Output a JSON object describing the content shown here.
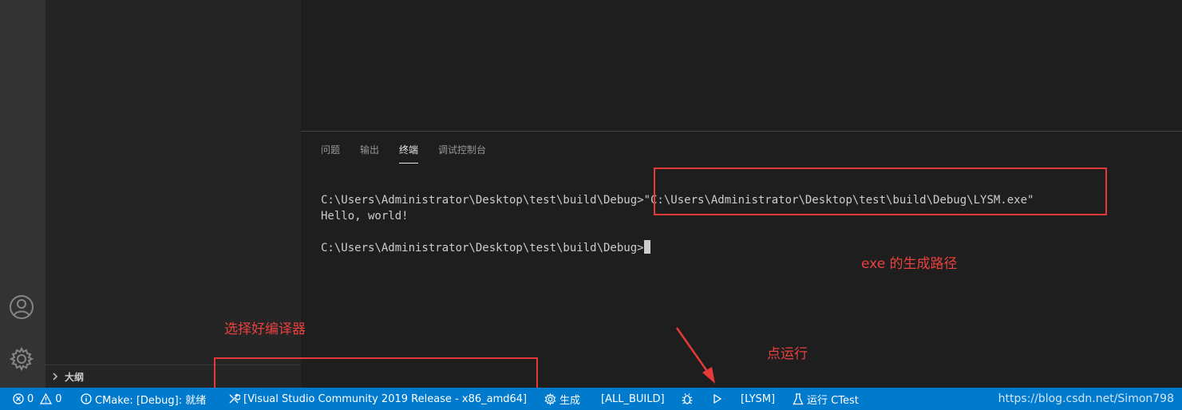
{
  "sidebar": {
    "outline_label": "大纲"
  },
  "panel": {
    "tabs": [
      {
        "label": "问题"
      },
      {
        "label": "输出"
      },
      {
        "label": "终端",
        "active": true
      },
      {
        "label": "调试控制台"
      }
    ]
  },
  "terminal": {
    "line1_prompt": "C:\\Users\\Administrator\\Desktop\\test\\build\\Debug>",
    "line1_command": "\"C:\\Users\\Administrator\\Desktop\\test\\build\\Debug\\LYSM.exe\"",
    "line2": "Hello, world!",
    "line3_prompt": "C:\\Users\\Administrator\\Desktop\\test\\build\\Debug>"
  },
  "annotations": {
    "exe_path": "exe 的生成路径",
    "choose_compiler": "选择好编译器",
    "click_run": "点运行",
    "color": "#e63a3a"
  },
  "statusbar": {
    "errors": "0",
    "warnings": "0",
    "cmake_status": "CMake: [Debug]: 就绪",
    "kit": "[Visual Studio Community 2019 Release - x86_amd64]",
    "build": "生成",
    "target": "[ALL_BUILD]",
    "launch_target": "[LYSM]",
    "ctest": "运行 CTest",
    "watermark": "https://blog.csdn.net/Simon798",
    "background": "#007acc"
  }
}
